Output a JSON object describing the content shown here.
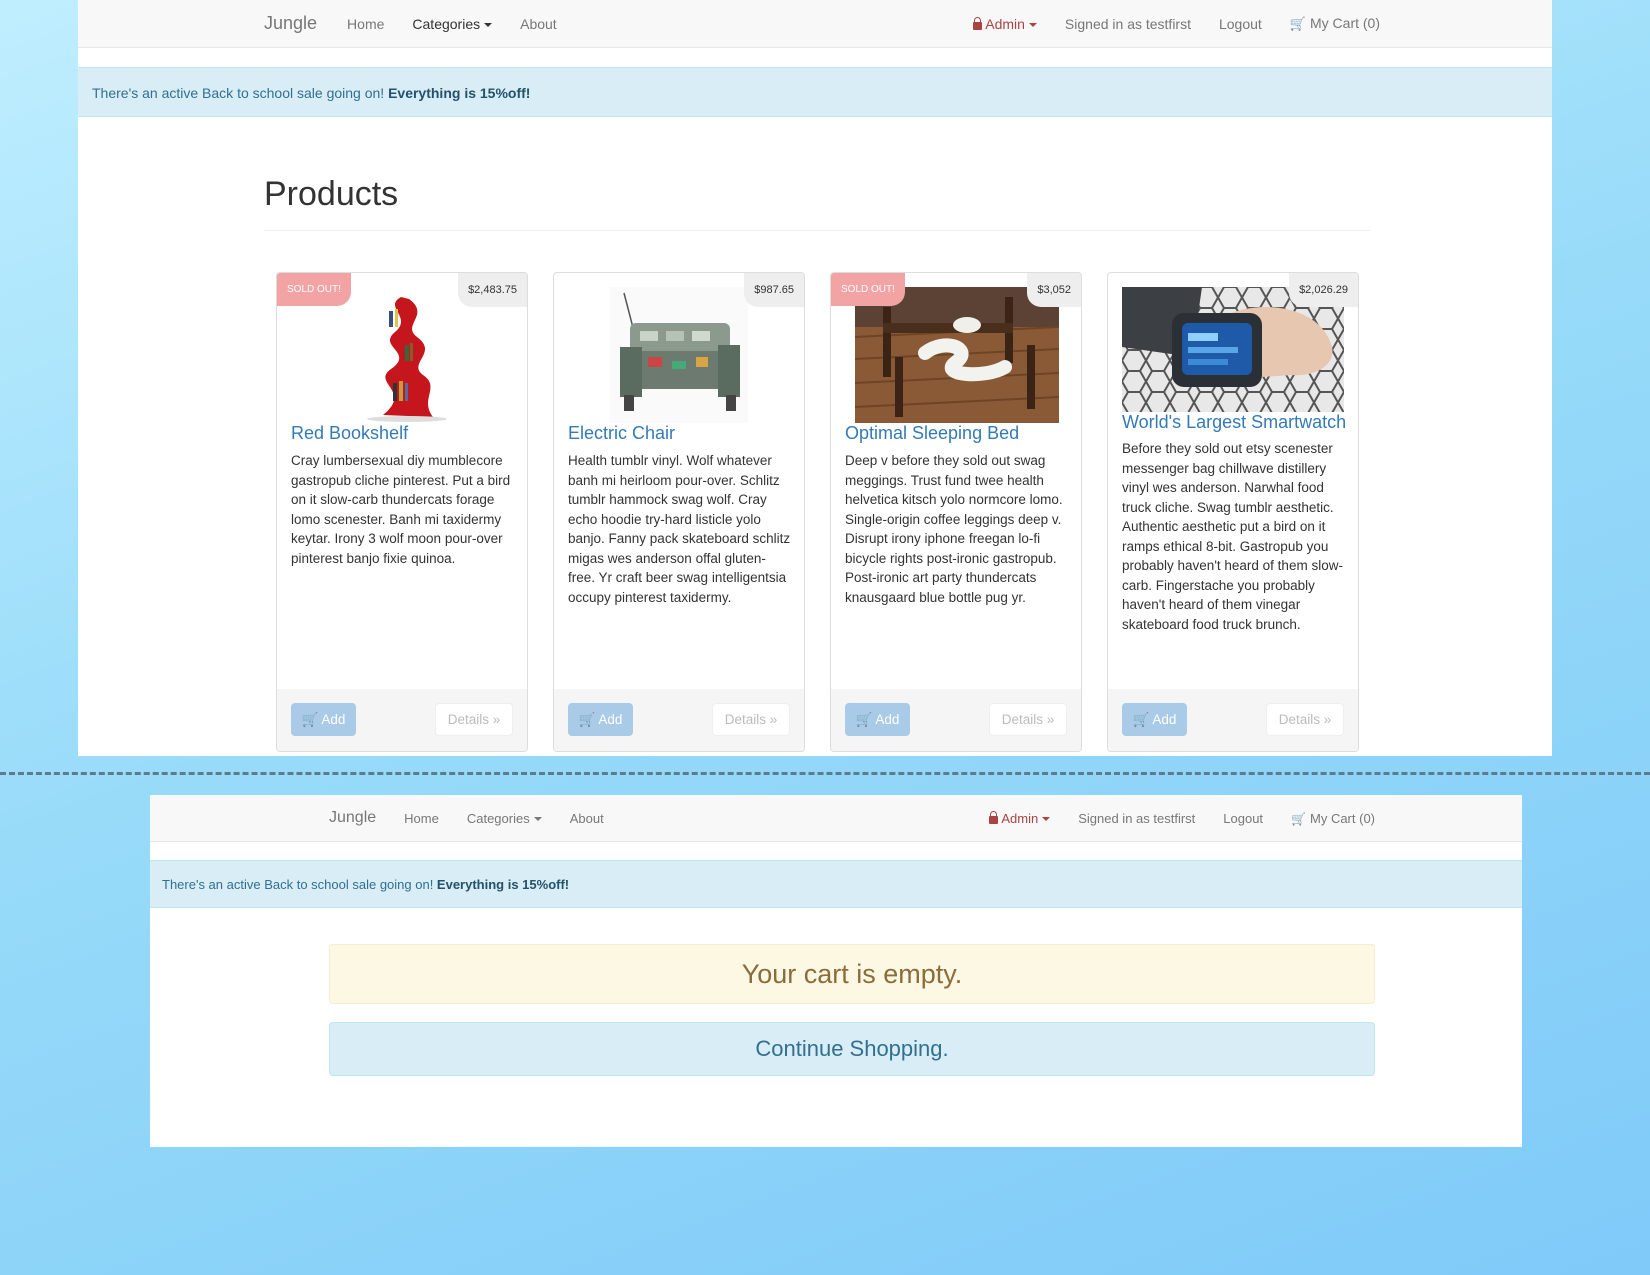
{
  "top": {
    "nav": {
      "brand": "Jungle",
      "home": "Home",
      "categories": "Categories",
      "about": "About",
      "admin": "Admin",
      "signed_in": "Signed in as testfirst",
      "logout": "Logout",
      "cart": "My Cart (0)"
    },
    "sale": {
      "text": "There's an active Back to school sale going on! ",
      "bold": "Everything is 15%off!"
    },
    "title": "Products",
    "products": [
      {
        "name": "Red Bookshelf",
        "price": "$2,483.75",
        "sold_out": "SOLD OUT!",
        "description": "Cray lumbersexual diy mumblecore gastropub cliche pinterest. Put a bird on it slow-carb thundercats forage lomo scenester. Banh mi taxidermy keytar. Irony 3 wolf moon pour-over pinterest banjo fixie quinoa.",
        "add": "Add",
        "details": "Details »"
      },
      {
        "name": "Electric Chair",
        "price": "$987.65",
        "description": "Health tumblr vinyl. Wolf whatever banh mi heirloom pour-over. Schlitz tumblr hammock swag wolf. Cray echo hoodie try-hard listicle yolo banjo. Fanny pack skateboard schlitz migas wes anderson offal gluten-free. Yr craft beer swag intelligentsia occupy pinterest taxidermy.",
        "add": "Add",
        "details": "Details »"
      },
      {
        "name": "Optimal Sleeping Bed",
        "price": "$3,052",
        "sold_out": "SOLD OUT!",
        "description": "Deep v before they sold out swag meggings. Trust fund twee health helvetica kitsch yolo normcore lomo. Single-origin coffee leggings deep v. Disrupt irony iphone freegan lo-fi bicycle rights post-ironic gastropub. Post-ironic art party thundercats knausgaard blue bottle pug yr.",
        "add": "Add",
        "details": "Details »"
      },
      {
        "name": "World's Largest Smartwatch",
        "price": "$2,026.29",
        "description": "Before they sold out etsy scenester messenger bag chillwave distillery vinyl wes anderson. Narwhal food truck cliche. Swag tumblr aesthetic. Authentic aesthetic put a bird on it ramps ethical 8-bit. Gastropub you probably haven't heard of them slow-carb. Fingerstache you probably haven't heard of them vinegar skateboard food truck brunch.",
        "add": "Add",
        "details": "Details »"
      }
    ]
  },
  "bottom": {
    "nav": {
      "brand": "Jungle",
      "home": "Home",
      "categories": "Categories",
      "about": "About",
      "admin": "Admin",
      "signed_in": "Signed in as testfirst",
      "logout": "Logout",
      "cart": "My Cart (0)"
    },
    "sale": {
      "text": "There's an active Back to school sale going on! ",
      "bold": "Everything is 15%off!"
    },
    "empty": "Your cart is empty.",
    "continue": "Continue Shopping."
  }
}
